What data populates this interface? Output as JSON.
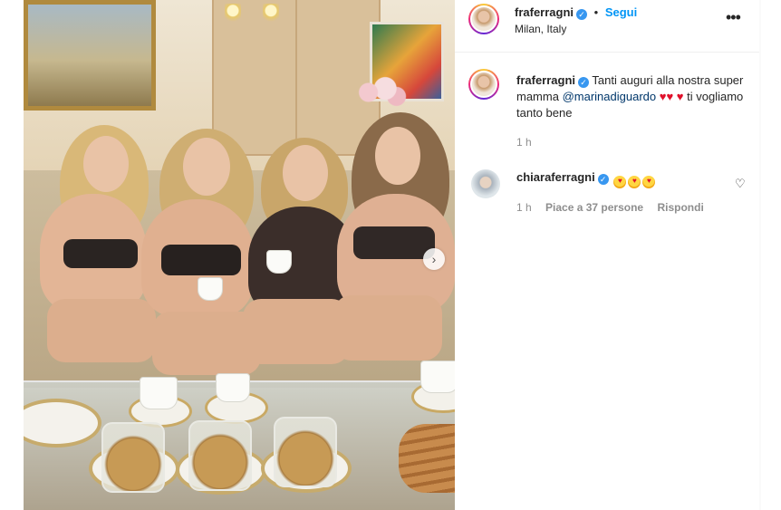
{
  "post": {
    "username": "fraferragni",
    "follow_label": "Segui",
    "separator": "•",
    "location": "Milan, Italy",
    "more_label": "•••",
    "next_label": "›"
  },
  "caption": {
    "username": "fraferragni",
    "text_before": "Tanti auguri alla nostra super mamma",
    "mention": "@marinadiguardo",
    "text_after": "ti vogliamo tanto bene",
    "heart": "♥",
    "time": "1 h"
  },
  "comments": [
    {
      "username": "chiaraferragni",
      "emoji": "♥",
      "time": "1 h",
      "likes": "Piace a 37 persone",
      "reply_label": "Rispondi",
      "like_icon": "♡"
    }
  ],
  "colors": {
    "accent": "#0095f6",
    "verified": "#3897f0",
    "heart": "#e0112b",
    "muted": "#8e8e8e",
    "mention": "#00376b"
  },
  "icons": [
    "verified-badge-icon",
    "more-options-icon",
    "next-arrow-icon",
    "heart-emoji-icon",
    "heart-eyes-emoji-icon",
    "like-outline-icon"
  ]
}
